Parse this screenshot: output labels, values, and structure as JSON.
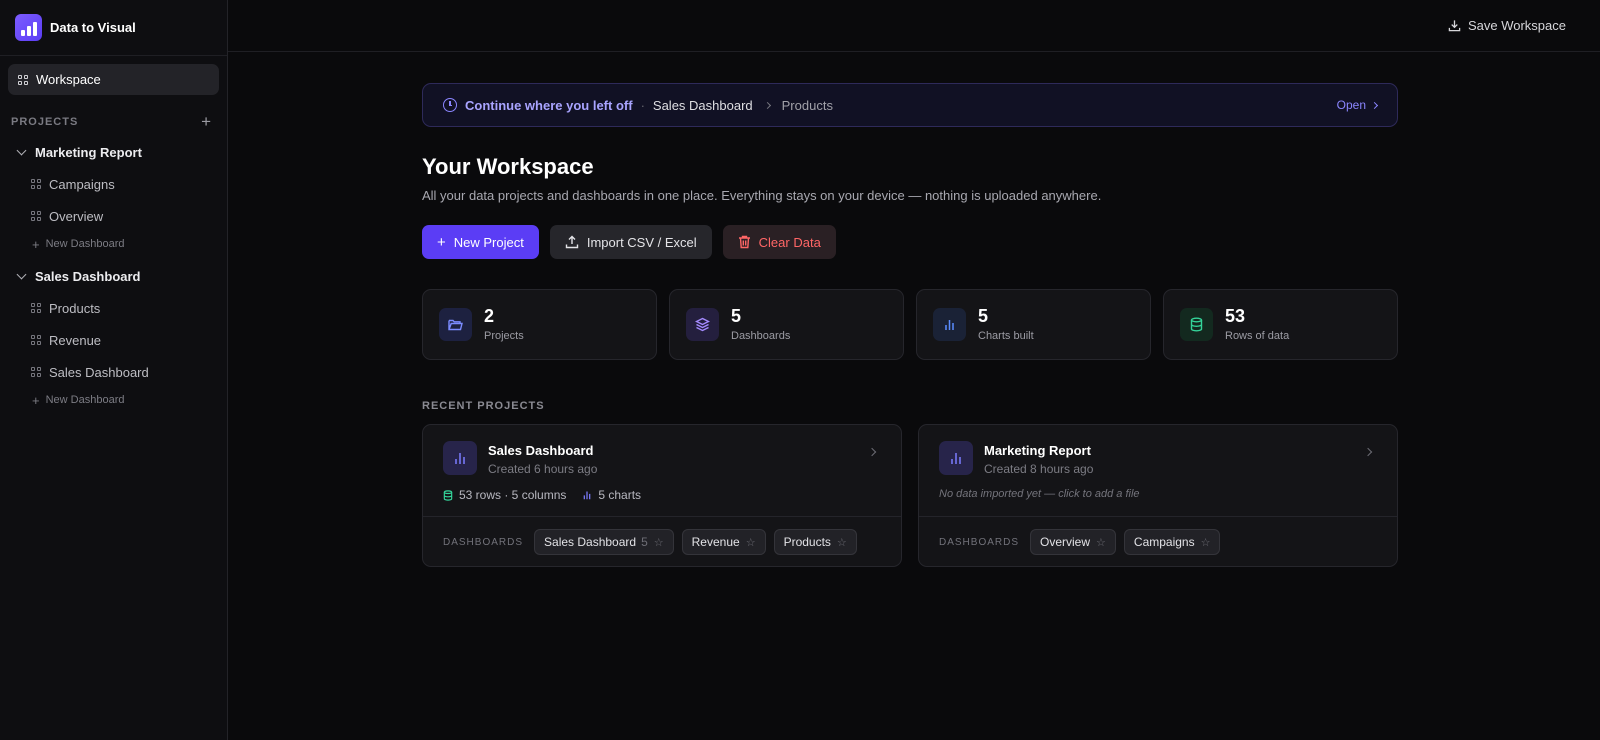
{
  "app": {
    "name": "Data to Visual"
  },
  "sidebar": {
    "workspace_label": "Workspace",
    "projects_label": "PROJECTS",
    "projects": [
      {
        "name": "Marketing Report",
        "dashboards": [
          "Campaigns",
          "Overview"
        ],
        "new_dashboard_label": "New Dashboard"
      },
      {
        "name": "Sales Dashboard",
        "dashboards": [
          "Products",
          "Revenue",
          "Sales Dashboard"
        ],
        "new_dashboard_label": "New Dashboard"
      }
    ]
  },
  "topbar": {
    "save_label": "Save Workspace"
  },
  "resume": {
    "label": "Continue where you left off",
    "separator": "·",
    "project": "Sales Dashboard",
    "dashboard": "Products",
    "open_label": "Open"
  },
  "main": {
    "title": "Your Workspace",
    "subtitle": "All your data projects and dashboards in one place. Everything stays on your device — nothing is uploaded anywhere.",
    "actions": {
      "new_project": "New Project",
      "import": "Import CSV / Excel",
      "clear": "Clear Data"
    },
    "stats": [
      {
        "value": "2",
        "label": "Projects",
        "icon": "folder-icon",
        "color": "#7c8cff"
      },
      {
        "value": "5",
        "label": "Dashboards",
        "icon": "layers-icon",
        "color": "#a58bff"
      },
      {
        "value": "5",
        "label": "Charts built",
        "icon": "bar-chart-icon",
        "color": "#5a8cff"
      },
      {
        "value": "53",
        "label": "Rows of data",
        "icon": "database-icon",
        "color": "#34d399"
      }
    ],
    "recent_label": "RECENT PROJECTS",
    "dashboards_label": "DASHBOARDS",
    "recent": [
      {
        "name": "Sales Dashboard",
        "created": "Created 6 hours ago",
        "rows": "53 rows · 5 columns",
        "charts": "5 charts",
        "empty_text": "",
        "dashboards": [
          {
            "name": "Sales Dashboard",
            "count": "5"
          },
          {
            "name": "Revenue",
            "count": ""
          },
          {
            "name": "Products",
            "count": ""
          }
        ]
      },
      {
        "name": "Marketing Report",
        "created": "Created 8 hours ago",
        "rows": "",
        "charts": "",
        "empty_text": "No data imported yet — click to add a file",
        "dashboards": [
          {
            "name": "Overview",
            "count": ""
          },
          {
            "name": "Campaigns",
            "count": ""
          }
        ]
      }
    ]
  },
  "colors": {
    "accent": "#5b3df5",
    "accent_text": "#a9a4ff",
    "danger": "#ff6666",
    "success": "#34d399"
  }
}
